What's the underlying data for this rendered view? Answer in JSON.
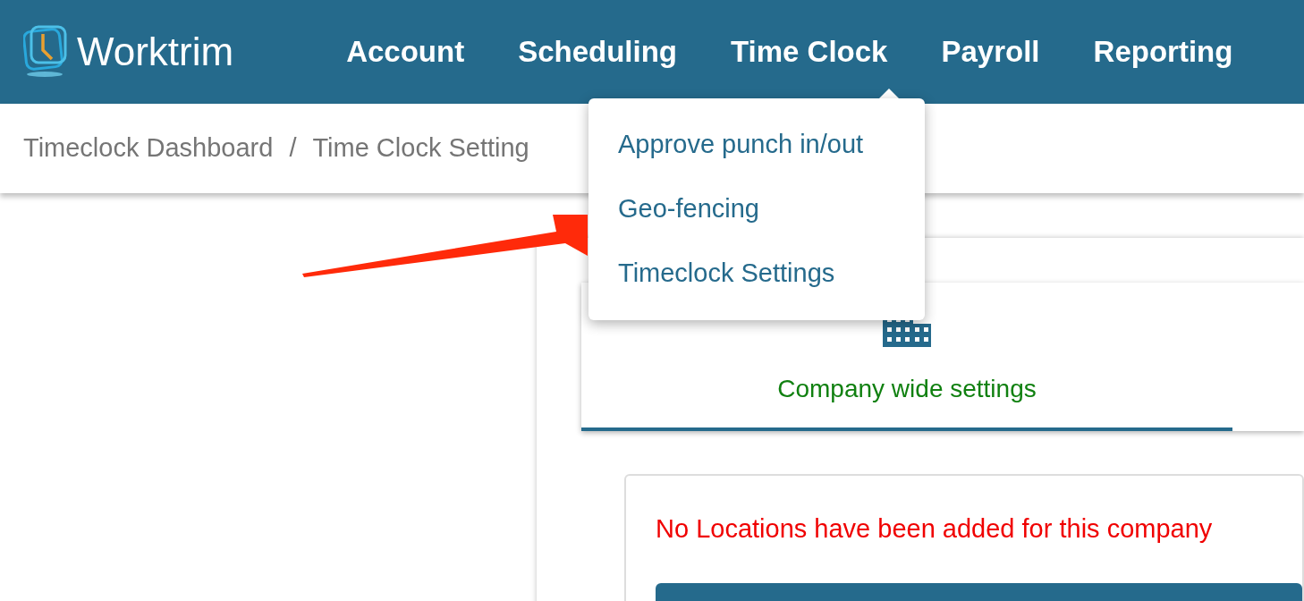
{
  "brand": "Worktrim",
  "nav": [
    "Account",
    "Scheduling",
    "Time Clock",
    "Payroll",
    "Reporting"
  ],
  "breadcrumb": [
    "Timeclock Dashboard",
    "/",
    "Time Clock Setting"
  ],
  "dropdown": [
    "Approve punch in/out",
    "Geo-fencing",
    "Timeclock Settings"
  ],
  "tabs": [
    {
      "label": "Company wide settings",
      "selected": true
    }
  ],
  "message": "No Locations have been added for this company"
}
